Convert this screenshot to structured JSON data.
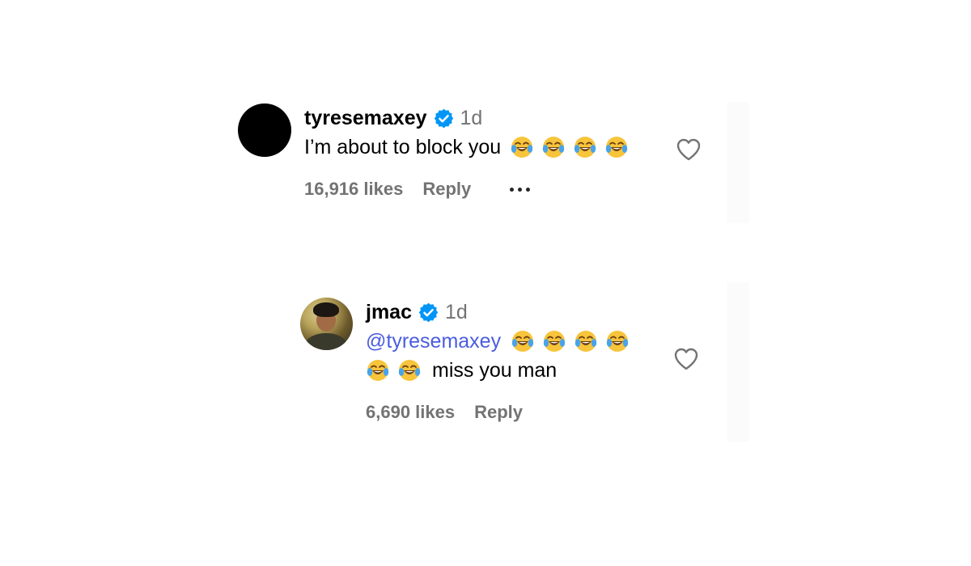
{
  "comments": [
    {
      "username": "tyresemaxey",
      "time": "1d",
      "text": "I’m about to block you",
      "emoji_count": 4,
      "likes": "16,916 likes",
      "reply_label": "Reply",
      "verified": true
    },
    {
      "username": "jmac",
      "time": "1d",
      "mention": "@tyresemaxey",
      "text": "miss you man",
      "emoji_count_line1": 4,
      "emoji_count_line2": 2,
      "likes": "6,690 likes",
      "reply_label": "Reply",
      "verified": true
    }
  ],
  "icons": {
    "verified": "verified-badge-icon",
    "emoji": "face-with-tears-of-joy-emoji",
    "heart": "heart-outline-icon",
    "more": "more-options-icon"
  },
  "colors": {
    "verified_blue": "#0095f6",
    "mention_blue": "#4a5de0",
    "secondary_text": "#737373"
  }
}
